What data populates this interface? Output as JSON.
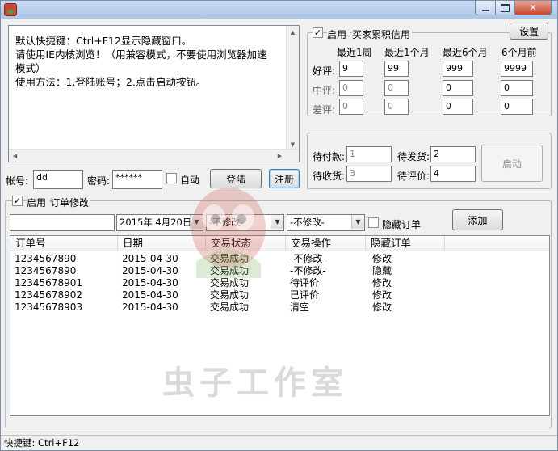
{
  "window": {
    "title": ""
  },
  "info": {
    "lines": [
      "默认快捷键：Ctrl+F12显示隐藏窗口。",
      "请使用IE内核浏览！（用兼容模式，不要使用浏览器加速模式）",
      "使用方法：1.登陆账号；2.点击启动按钮。"
    ]
  },
  "login": {
    "account_label": "帐号:",
    "account_value": "dd",
    "password_label": "密码:",
    "password_value": "******",
    "auto_label": "自动",
    "login_button": "登陆",
    "register_button": "注册"
  },
  "credit": {
    "enable_label": "启用",
    "group_title": "买家累积信用",
    "settings_button": "设置",
    "col_headers": [
      "最近1周",
      "最近1个月",
      "最近6个月",
      "6个月前"
    ],
    "rows": [
      {
        "label": "好评:",
        "values": [
          "9",
          "99",
          "999",
          "9999"
        ]
      },
      {
        "label": "中评:",
        "values": [
          "0",
          "0",
          "0",
          "0"
        ]
      },
      {
        "label": "差评:",
        "values": [
          "0",
          "0",
          "0",
          "0"
        ]
      }
    ]
  },
  "status": {
    "pending_pay_label": "待付款:",
    "pending_pay_value": "1",
    "pending_ship_label": "待发货:",
    "pending_ship_value": "2",
    "pending_receive_label": "待收货:",
    "pending_receive_value": "3",
    "pending_review_label": "待评价:",
    "pending_review_value": "4",
    "start_button": "启动"
  },
  "orders": {
    "enable_label": "启用",
    "group_title": "订单修改",
    "order_input": "",
    "date_value": "2015年 4月20日",
    "combo1": "-不修改-",
    "combo2": "-不修改-",
    "hide_label": "隐藏订单",
    "add_button": "添加",
    "columns": [
      "订单号",
      "日期",
      "交易状态",
      "交易操作",
      "隐藏订单"
    ],
    "rows": [
      [
        "1234567890",
        "2015-04-30",
        "交易成功",
        "-不修改-",
        "修改"
      ],
      [
        "1234567890",
        "2015-04-30",
        "交易成功",
        "-不修改-",
        "隐藏"
      ],
      [
        "12345678901",
        "2015-04-30",
        "交易成功",
        "待评价",
        "修改"
      ],
      [
        "12345678902",
        "2015-04-30",
        "交易成功",
        "已评价",
        "修改"
      ],
      [
        "12345678903",
        "2015-04-30",
        "交易成功",
        "清空",
        "修改"
      ]
    ]
  },
  "watermark": "虫子工作室",
  "statusbar": {
    "text": "快捷键: Ctrl+F12"
  },
  "icons": {
    "check": "✓",
    "arrow_up": "▲",
    "arrow_down": "▼",
    "arrow_left": "◀",
    "arrow_right": "▶",
    "dropdown": "▼"
  }
}
